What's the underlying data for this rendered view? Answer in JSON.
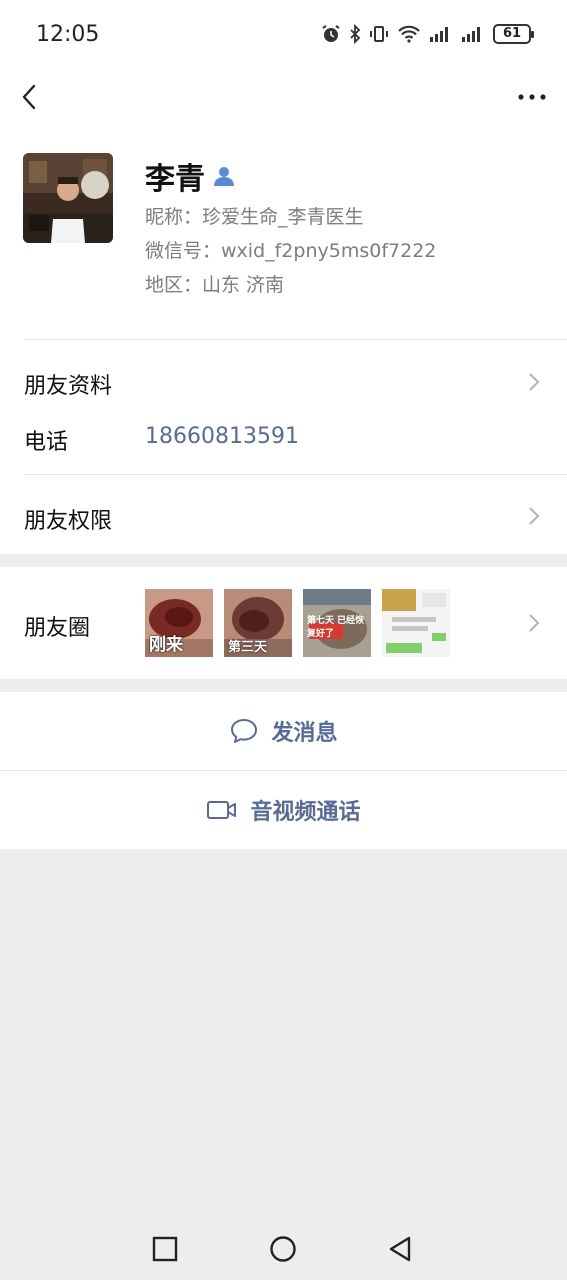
{
  "status_bar": {
    "time": "12:05",
    "battery": "61"
  },
  "nav": {
    "back_icon": "chevron-left-icon",
    "more_icon": "more-dots-icon"
  },
  "profile": {
    "name": "李青",
    "nickname": "昵称：珍爱生命_李青医生",
    "wechat_id": "微信号：wxid_f2pny5ms0f7222",
    "region": "地区：山东  济南"
  },
  "rows": {
    "friend_info": "朋友资料",
    "phone_label": "电话",
    "phone_number": "18660813591",
    "permissions": "朋友权限",
    "moments": "朋友圈"
  },
  "moments_thumbs": [
    {
      "caption": "刚来"
    },
    {
      "caption": "第三天"
    },
    {
      "caption": "第七天 已经恢复好了"
    },
    {
      "caption": ""
    }
  ],
  "actions": {
    "send_message": "发消息",
    "video_call": "音视频通话"
  },
  "colors": {
    "link": "#576b95",
    "background": "#ededed"
  }
}
